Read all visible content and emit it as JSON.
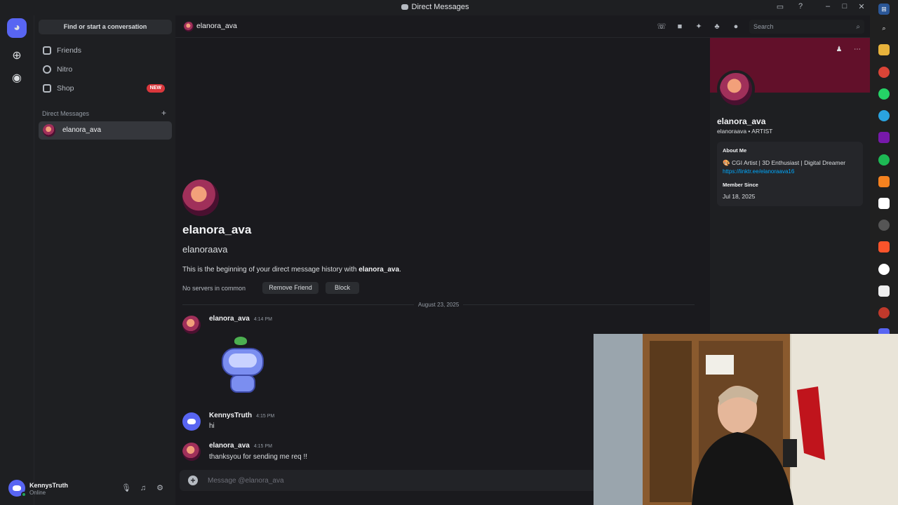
{
  "window": {
    "title": "Direct Messages"
  },
  "rail": {
    "home_icon": "discord-icon",
    "add_icon": "plus-icon",
    "explore_icon": "compass-icon"
  },
  "sidebar": {
    "find_button": "Find or start a conversation",
    "nav": [
      {
        "label": "Friends",
        "icon": "friends-icon"
      },
      {
        "label": "Nitro",
        "icon": "nitro-icon"
      },
      {
        "label": "Shop",
        "icon": "shop-icon",
        "badge": "NEW"
      }
    ],
    "dm_header": "Direct Messages",
    "dms": [
      {
        "name": "elanora_ava"
      }
    ]
  },
  "user_panel": {
    "username": "KennysTruth",
    "status": "Online"
  },
  "header": {
    "channel_name": "elanora_ava",
    "search_placeholder": "Search"
  },
  "intro": {
    "display_name": "elanora_ava",
    "username": "elanoraava",
    "text_prefix": "This is the beginning of your direct message history with ",
    "text_name": "elanora_ava",
    "text_suffix": ".",
    "no_servers": "No servers in common",
    "remove_friend": "Remove Friend",
    "block": "Block"
  },
  "date_divider": "August 23, 2025",
  "messages": [
    {
      "author": "elanora_ava",
      "time": "4:14 PM",
      "text": ""
    },
    {
      "author": "KennysTruth",
      "time": "4:15 PM",
      "text": "hi"
    },
    {
      "author": "elanora_ava",
      "time": "4:15 PM",
      "text": "thanksyou for sending me req !!"
    }
  ],
  "composer": {
    "placeholder": "Message @elanora_ava"
  },
  "profile": {
    "display_name": "elanora_ava",
    "subtitle": "elanoraava • ARTIST",
    "about_title": "About Me",
    "about_text": "CGI Artist | 3D Enthusiast | Digital Dreamer",
    "about_link": "https://linktr.ee/elanoraava16",
    "member_title": "Member Since",
    "member_date": "Jul 18, 2025"
  },
  "colors": {
    "accent": "#5865f2",
    "banner": "#62102a",
    "badge": "#da373c",
    "link": "#00a8fc"
  }
}
